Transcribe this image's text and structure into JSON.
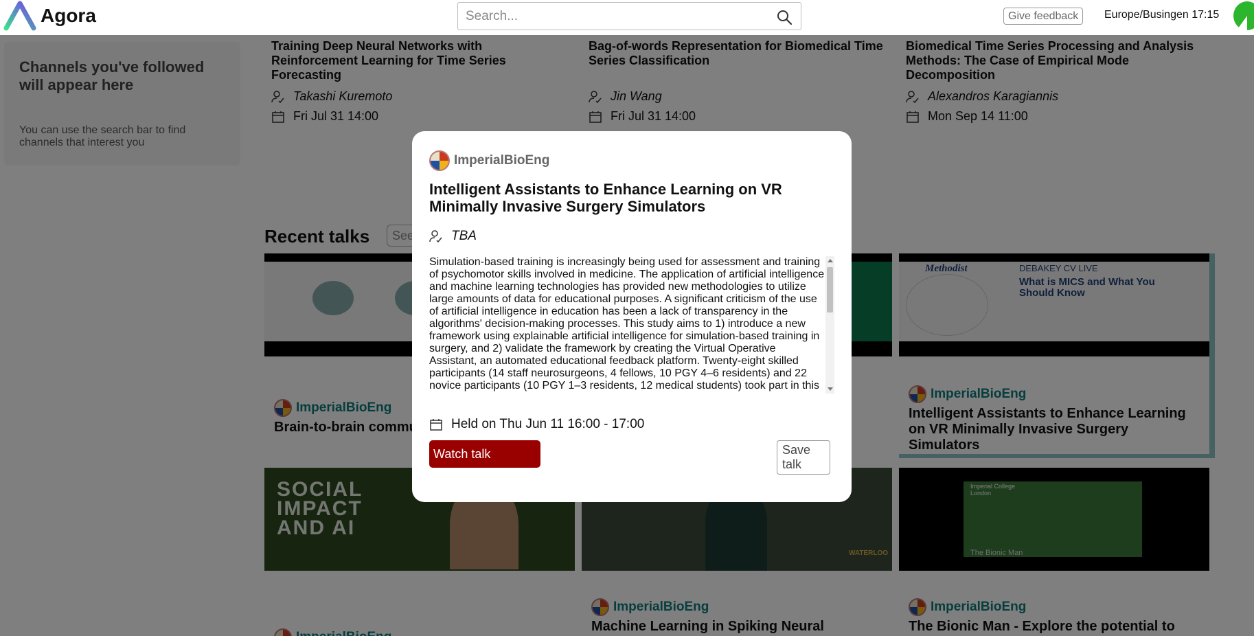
{
  "header": {
    "app_name": "Agora",
    "search_placeholder": "Search...",
    "feedback_label": "Give feedback",
    "timezone_clock": "Europe/Busingen 17:15"
  },
  "sidebar": {
    "heading": "Channels you've followed will appear here",
    "hint": "You can use the search bar to find channels that interest you"
  },
  "upcoming": [
    {
      "title": "Training Deep Neural Networks with Reinforcement Learning for Time Series Forecasting",
      "speaker": "Takashi Kuremoto",
      "date": "Fri Jul 31 14:00"
    },
    {
      "title": "Bag-of-words Representation for Biomedical Time Series Classification",
      "speaker": "Jin Wang",
      "date": "Fri Jul 31 14:00"
    },
    {
      "title": "Biomedical Time Series Processing and Analysis Methods: The Case of Empirical Mode Decomposition",
      "speaker": "Alexandros Karagiannis",
      "date": "Mon Sep 14 11:00"
    }
  ],
  "recent": {
    "heading": "Recent talks",
    "see_all_partial": "See",
    "tiles": [
      {
        "channel": "ImperialBioEng",
        "title": "Brain-to-brain commu advances"
      },
      {
        "channel": "ImperialBioEng",
        "title": "Intelligent Assistants to Enhance Learning on VR Minimally Invasive Surgery Simulators"
      },
      {
        "channel": "ImperialBioEng",
        "title": "Machine Learning in Spiking Neural"
      },
      {
        "channel": "ImperialBioEng",
        "title": "The Bionic Man - Explore the potential to"
      },
      {
        "channel": "ImperialBioEng",
        "title": ""
      }
    ],
    "thumb_texts": {
      "social_impact": "SOCIAL IMPACT AND AI",
      "methodist": "Methodist",
      "debakey": "DEBAKEY CV LIVE",
      "mics": "What is MICS and What You Should Know",
      "imperial": "Imperial College London",
      "bionic": "The Bionic Man",
      "waterloo": "WATERLOO"
    }
  },
  "modal": {
    "channel": "ImperialBioEng",
    "title": "Intelligent Assistants to Enhance Learning on VR Minimally Invasive Surgery Simulators",
    "speaker": "TBA",
    "abstract": "Simulation-based training is increasingly being used for assessment and training of psychomotor skills involved in medicine. The application of artificial intelligence and machine learning technologies has provided new methodologies to utilize large amounts of data for educational purposes. A significant criticism of the use of artificial intelligence in education has been a lack of transparency in the algorithms' decision-making processes. This study aims to 1) introduce a new framework using explainable artificial intelligence for simulation-based training in surgery, and 2) validate the framework by creating the Virtual Operative Assistant, an automated educational feedback platform. Twenty-eight skilled participants (14 staff neurosurgeons, 4 fellows, 10 PGY 4–6 residents) and 22 novice participants (10 PGY 1–3 residents, 12 medical students) took part in this",
    "held": "Held on Thu Jun 11 16:00 - 17:00",
    "watch_label": "Watch talk",
    "save_label": "Save talk"
  }
}
